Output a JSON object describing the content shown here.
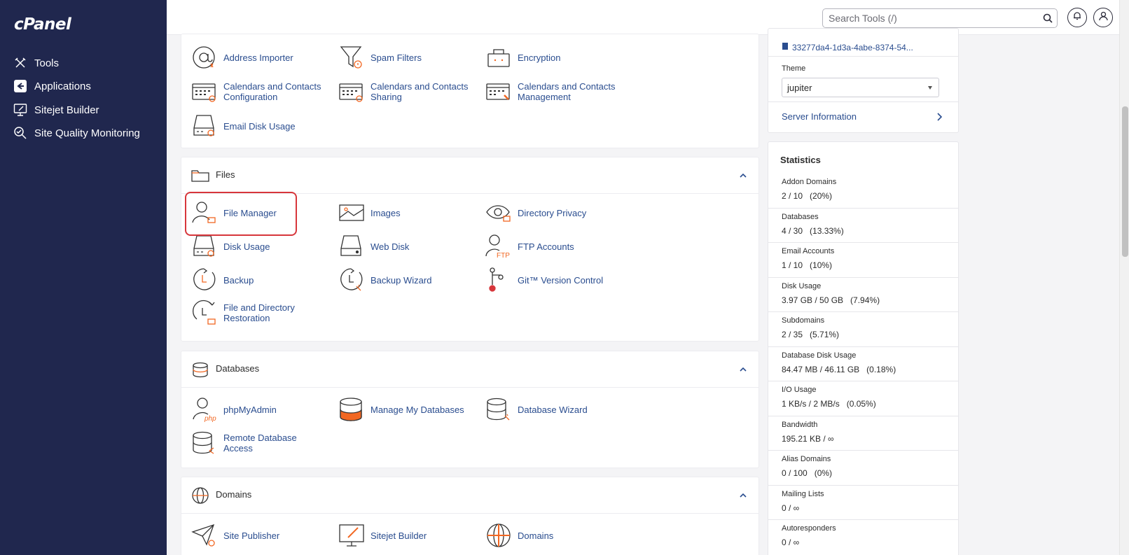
{
  "sidebar": {
    "logo": "cPanel",
    "items": [
      {
        "label": "Tools",
        "icon": "tools-icon"
      },
      {
        "label": "Applications",
        "icon": "applications-icon"
      },
      {
        "label": "Sitejet Builder",
        "icon": "sitejet-icon"
      },
      {
        "label": "Site Quality Monitoring",
        "icon": "site-quality-icon"
      }
    ]
  },
  "header": {
    "search_placeholder": "Search Tools (/)",
    "icons": [
      "search-icon",
      "bell-icon",
      "user-icon"
    ]
  },
  "email_section": {
    "items": [
      {
        "label": "Address Importer",
        "icon": "address-importer-icon"
      },
      {
        "label": "Spam Filters",
        "icon": "spam-filters-icon"
      },
      {
        "label": "Encryption",
        "icon": "encryption-icon"
      },
      {
        "label": "Calendars and Contacts Configuration",
        "icon": "calendar-config-icon"
      },
      {
        "label": "Calendars and Contacts Sharing",
        "icon": "calendar-sharing-icon"
      },
      {
        "label": "Calendars and Contacts Management",
        "icon": "calendar-management-icon"
      },
      {
        "label": "Email Disk Usage",
        "icon": "email-disk-usage-icon"
      }
    ]
  },
  "files": {
    "title": "Files",
    "items": [
      {
        "label": "File Manager",
        "icon": "file-manager-icon"
      },
      {
        "label": "Images",
        "icon": "images-icon"
      },
      {
        "label": "Directory Privacy",
        "icon": "directory-privacy-icon"
      },
      {
        "label": "Disk Usage",
        "icon": "disk-usage-icon"
      },
      {
        "label": "Web Disk",
        "icon": "web-disk-icon"
      },
      {
        "label": "FTP Accounts",
        "icon": "ftp-accounts-icon"
      },
      {
        "label": "Backup",
        "icon": "backup-icon"
      },
      {
        "label": "Backup Wizard",
        "icon": "backup-wizard-icon"
      },
      {
        "label": "Git™ Version Control",
        "icon": "git-icon"
      },
      {
        "label": "File and Directory Restoration",
        "icon": "restoration-icon"
      }
    ]
  },
  "databases": {
    "title": "Databases",
    "items": [
      {
        "label": "phpMyAdmin",
        "icon": "phpmyadmin-icon"
      },
      {
        "label": "Manage My Databases",
        "icon": "manage-databases-icon"
      },
      {
        "label": "Database Wizard",
        "icon": "database-wizard-icon"
      },
      {
        "label": "Remote Database Access",
        "icon": "remote-database-icon"
      }
    ]
  },
  "domains": {
    "title": "Domains",
    "items": [
      {
        "label": "Site Publisher",
        "icon": "site-publisher-icon"
      },
      {
        "label": "Sitejet Builder",
        "icon": "sitejet-builder-icon"
      },
      {
        "label": "Domains",
        "icon": "domains-icon"
      }
    ]
  },
  "right_panel": {
    "uuid": "33277da4-1d3a-4abe-8374-54...",
    "theme_label": "Theme",
    "theme_value": "jupiter",
    "server_info": "Server Information",
    "statistics_title": "Statistics",
    "stats": [
      {
        "label": "Addon Domains",
        "value": "2 / 10   (20%)"
      },
      {
        "label": "Databases",
        "value": "4 / 30   (13.33%)"
      },
      {
        "label": "Email Accounts",
        "value": "1 / 10   (10%)"
      },
      {
        "label": "Disk Usage",
        "value": "3.97 GB / 50 GB   (7.94%)"
      },
      {
        "label": "Subdomains",
        "value": "2 / 35   (5.71%)"
      },
      {
        "label": "Database Disk Usage",
        "value": "84.47 MB / 46.11 GB   (0.18%)"
      },
      {
        "label": "I/O Usage",
        "value": "1 KB/s / 2 MB/s   (0.05%)"
      },
      {
        "label": "Bandwidth",
        "value": "195.21 KB / ∞"
      },
      {
        "label": "Alias Domains",
        "value": "0 / 100   (0%)"
      },
      {
        "label": "Mailing Lists",
        "value": "0 / ∞"
      },
      {
        "label": "Autoresponders",
        "value": "0 / ∞"
      }
    ]
  },
  "colors": {
    "sidebar_bg": "#20274e",
    "link": "#2a4d8f",
    "accent": "#f26722",
    "highlight": "#d7363b"
  }
}
